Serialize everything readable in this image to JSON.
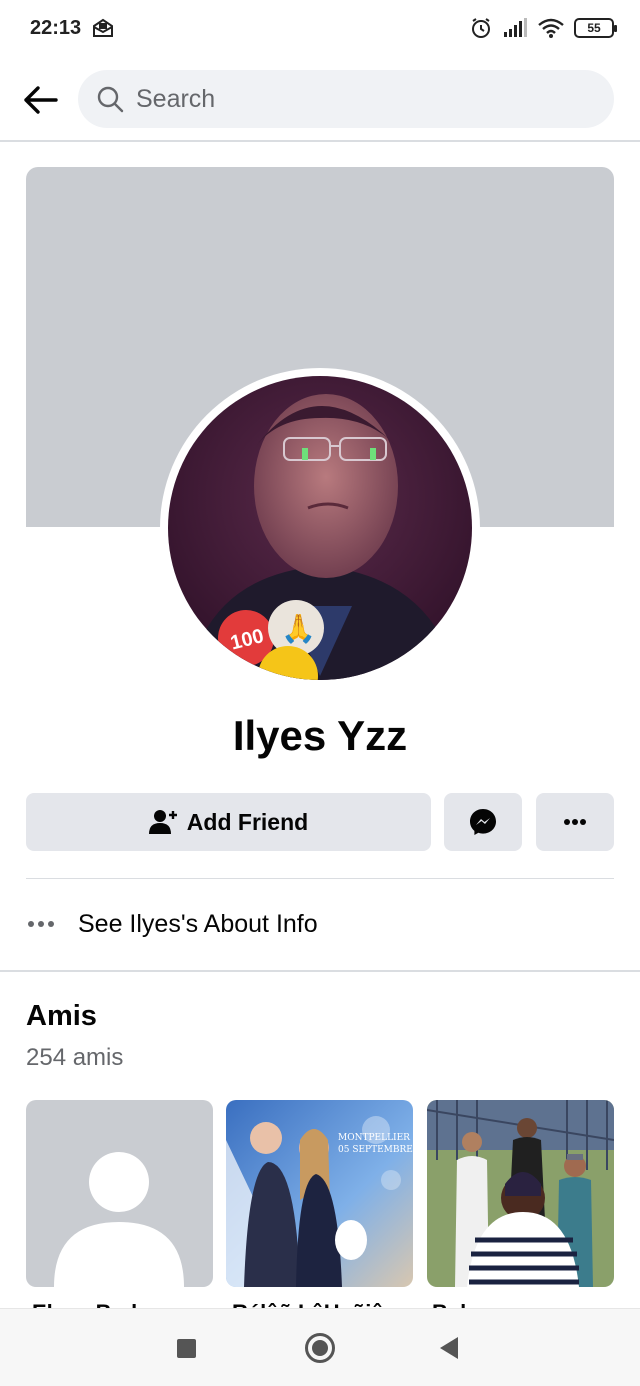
{
  "status_bar": {
    "time": "22:13",
    "battery": "55",
    "icons": [
      "mail-icon",
      "alarm-icon",
      "signal-icon",
      "wifi-icon",
      "battery-icon"
    ]
  },
  "topnav": {
    "search_placeholder": "Search"
  },
  "profile": {
    "name": "Ilyes Yzz",
    "avatar_stickers": [
      "100",
      "🙏"
    ]
  },
  "actions": {
    "add_friend_label": "Add Friend",
    "message_icon": "messenger-icon",
    "more_icon": "more-icon"
  },
  "about": {
    "label": "See Ilyes's About Info"
  },
  "friends": {
    "title": "Amis",
    "count": "254 amis",
    "photo_captions": [
      "MONTPELLIER",
      "05 SEPTEMBRE"
    ],
    "items": [
      {
        "name": "Elyas Bed"
      },
      {
        "name": "Rélâñ LâHañiâ"
      },
      {
        "name": "Belo"
      }
    ]
  },
  "colors": {
    "accent": "#1877f2",
    "cover": "#c9ccd1",
    "button": "#e4e6eb",
    "secondary_text": "#65676b"
  }
}
